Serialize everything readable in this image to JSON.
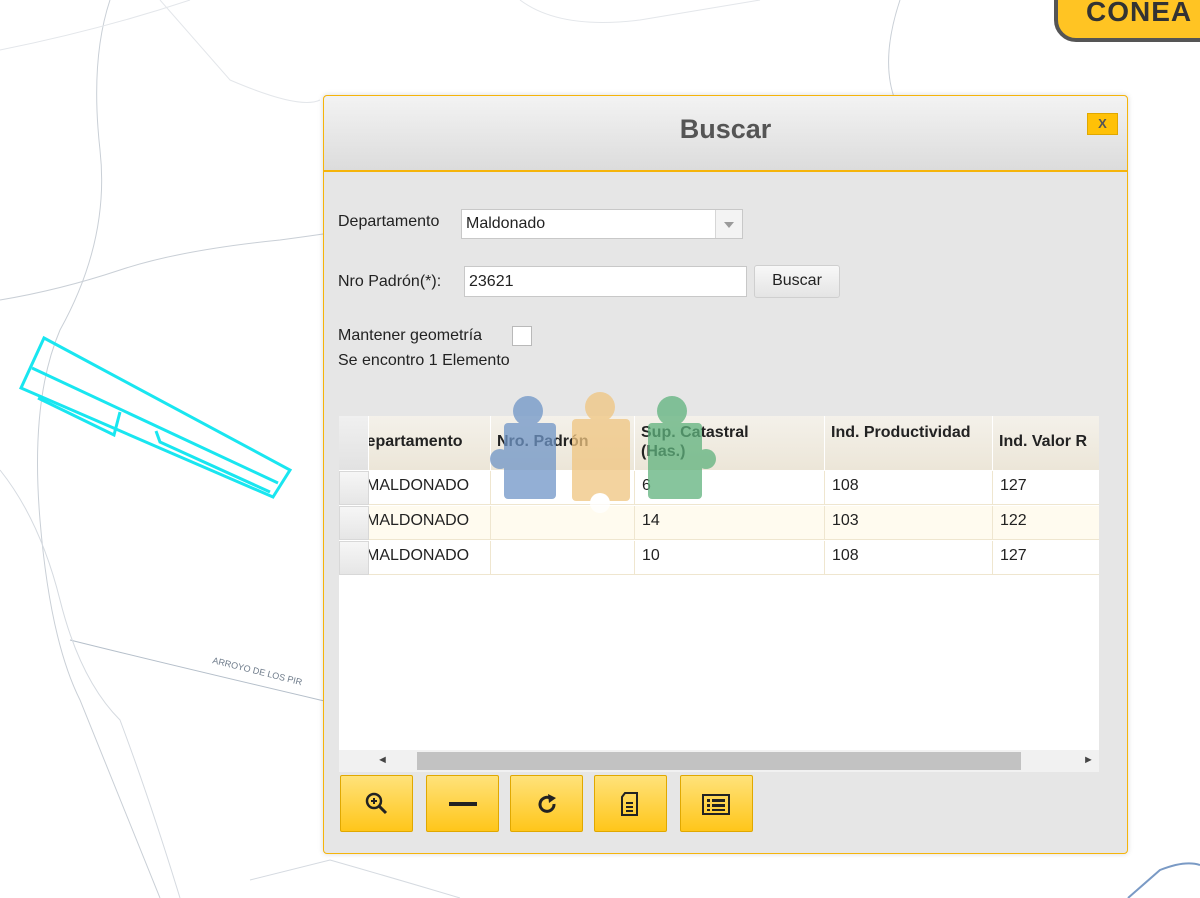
{
  "brand": {
    "label": "CONEA"
  },
  "map": {
    "road_label": "ARROYO DE LOS PIR",
    "map_number": "39",
    "highlight_color": "#19e6f0"
  },
  "dialog": {
    "title": "Buscar",
    "close_label": "X",
    "departamento_label": "Departamento",
    "departamento_value": "Maldonado",
    "padron_label": "Nro Padrón(*):",
    "padron_value": "23621",
    "buscar_label": "Buscar",
    "mantener_label": "Mantener geometría",
    "result_text": "Se encontro 1 Elemento"
  },
  "grid": {
    "columns": [
      {
        "label": "Departamento"
      },
      {
        "label": "Nro. Padrón"
      },
      {
        "label": "Sup. Catastral (Has.)"
      },
      {
        "label": "Ind. Productividad"
      },
      {
        "label": "Ind. Valor R"
      }
    ],
    "rows": [
      [
        "MALDONADO",
        "",
        "6",
        "108",
        "127"
      ],
      [
        "MALDONADO",
        "",
        "14",
        "103",
        "122"
      ],
      [
        "MALDONADO",
        "",
        "10",
        "108",
        "127"
      ]
    ]
  },
  "toolbar": {
    "buttons": [
      {
        "icon": "zoom-in-icon"
      },
      {
        "icon": "minus-icon"
      },
      {
        "icon": "refresh-icon"
      },
      {
        "icon": "document-icon"
      },
      {
        "icon": "list-icon"
      }
    ]
  }
}
